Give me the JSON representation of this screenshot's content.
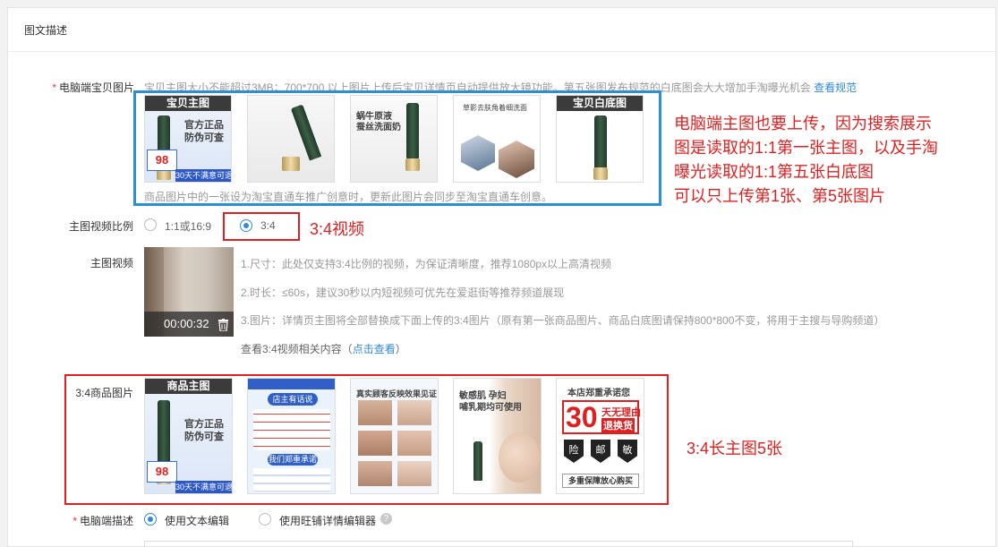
{
  "panel": {
    "title": "图文描述"
  },
  "pc_main_images": {
    "label": "电脑端宝贝图片",
    "hint": "宝贝主图大小不能超过3MB；700*700 以上图片上传后宝贝详情页自动提供放大镜功能。第五张图发布规范的白底图会大大增加手淘曝光机会",
    "hint_link": "查看规范",
    "note": "商品图片中的一张设为淘宝直通车推广创意时，更新此图片会同步至淘宝直通车创意。",
    "thumb1_caption": "宝贝主图",
    "thumb1_line1": "官方正品",
    "thumb1_line2": "防伪可查",
    "thumb1_price": "98",
    "thumb1_ribbon": "30天不满意可退",
    "thumb3_line1": "蜗牛原液",
    "thumb3_line2": "蚕丝洗面奶",
    "thumb4_line1": "草影去肤角着细洗面",
    "thumb5_caption": "宝贝白底图"
  },
  "annotation_pc": {
    "lines": [
      "电脑端主图也要上传，因为搜索展示",
      "图是读取的1:1第一张主图，以及手淘",
      "曝光读取的1:1第五张白底图",
      "可以只上传第1张、第5张图片"
    ]
  },
  "ratio": {
    "label": "主图视频比例",
    "option1": "1:1或16:9",
    "option2": "3:4",
    "selected": "3:4",
    "annotation": "3:4视频"
  },
  "video": {
    "label": "主图视频",
    "duration": "00:00:32",
    "rules": [
      "1.尺寸：此处仅支持3:4比例的视频，为保证清晰度，推荐1080px以上高清视频",
      "2.时长：≤60s，建议30秒以内短视频可优先在爱逛街等推荐频道展现",
      "3.图片：详情页主图将全部替换成下面上传的3:4图片（原有第一张商品图片、商品白底图请保持800*800不变，将用于主搜与导购频道）"
    ],
    "more_text_prefix": "查看3:4视频相关内容（",
    "more_link": "点击查看",
    "more_text_suffix": "）"
  },
  "images_34": {
    "label": "3:4商品图片",
    "annotation": "3:4长主图5张",
    "t1_caption": "商品主图",
    "t1_line1": "官方正品",
    "t1_line2": "防伪可查",
    "t1_price": "98",
    "t1_ribbon": "30天不满意可退",
    "t2_head": "店主有话说",
    "t2_promise": "我们郑重承诺",
    "t3_head": "真实顾客反映效果见证",
    "t4_line1": "敏感肌 孕妇",
    "t4_line2": "哺乳期均可使用",
    "t5_head": "本店郑重承诺您",
    "t5_big": "30",
    "t5_line1": "天无理由",
    "t5_line2": "退换货",
    "t5_badge1": "险",
    "t5_badge2": "邮",
    "t5_badge3": "敏",
    "t5_footer": "多重保障放心购买"
  },
  "pc_desc": {
    "label": "电脑端描述",
    "option1": "使用文本编辑",
    "option2": "使用旺铺详情编辑器",
    "selected": "使用文本编辑"
  },
  "colors": {
    "accent": "#3089dc",
    "annotation_red": "#e02020",
    "annotation_blue": "#2b8fd8",
    "required": "#e4393c"
  }
}
